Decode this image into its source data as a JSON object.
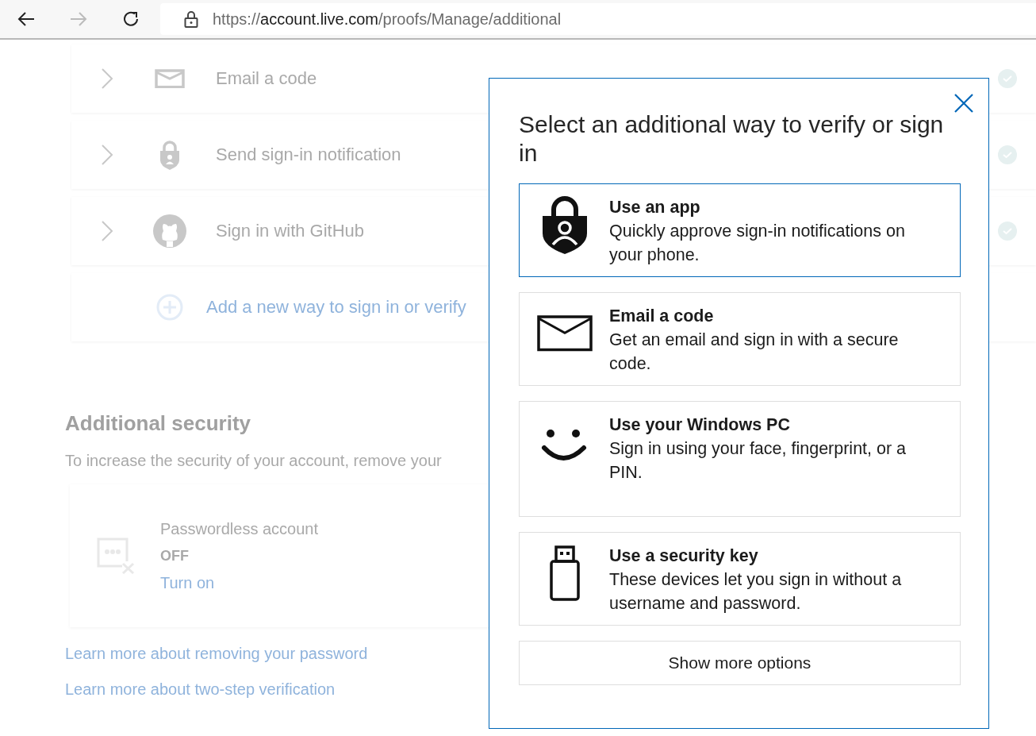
{
  "browser": {
    "url_scheme": "https://",
    "url_host": "account.live.com",
    "url_path": "/proofs/Manage/additional"
  },
  "methods": [
    {
      "kind": "email",
      "label": "Email a code",
      "verified": true
    },
    {
      "kind": "notification",
      "label": "Send sign-in notification",
      "verified": true
    },
    {
      "kind": "github",
      "label": "Sign in with GitHub",
      "verified": true
    }
  ],
  "add_method": "Add a new way to sign in or verify",
  "additional_security": {
    "heading": "Additional security",
    "description": "To increase the security of your account, remove your",
    "card": {
      "title": "Passwordless account",
      "status": "OFF",
      "action": "Turn on"
    },
    "links": [
      "Learn more about removing your password",
      "Learn more about two-step verification"
    ]
  },
  "dialog": {
    "title": "Select an additional way to verify or sign in",
    "options": [
      {
        "kind": "app",
        "title": "Use an app",
        "description": "Quickly approve sign-in notifications on your phone.",
        "selected": true
      },
      {
        "kind": "email",
        "title": "Email a code",
        "description": "Get an email and sign in with a secure code.",
        "selected": false
      },
      {
        "kind": "windows-hello",
        "title": "Use your Windows PC",
        "description": "Sign in using your face, fingerprint, or a PIN.",
        "selected": false
      },
      {
        "kind": "security-key",
        "title": "Use a security key",
        "description": "These devices let you sign in without a username and password.",
        "selected": false
      }
    ],
    "show_more": "Show more options"
  }
}
